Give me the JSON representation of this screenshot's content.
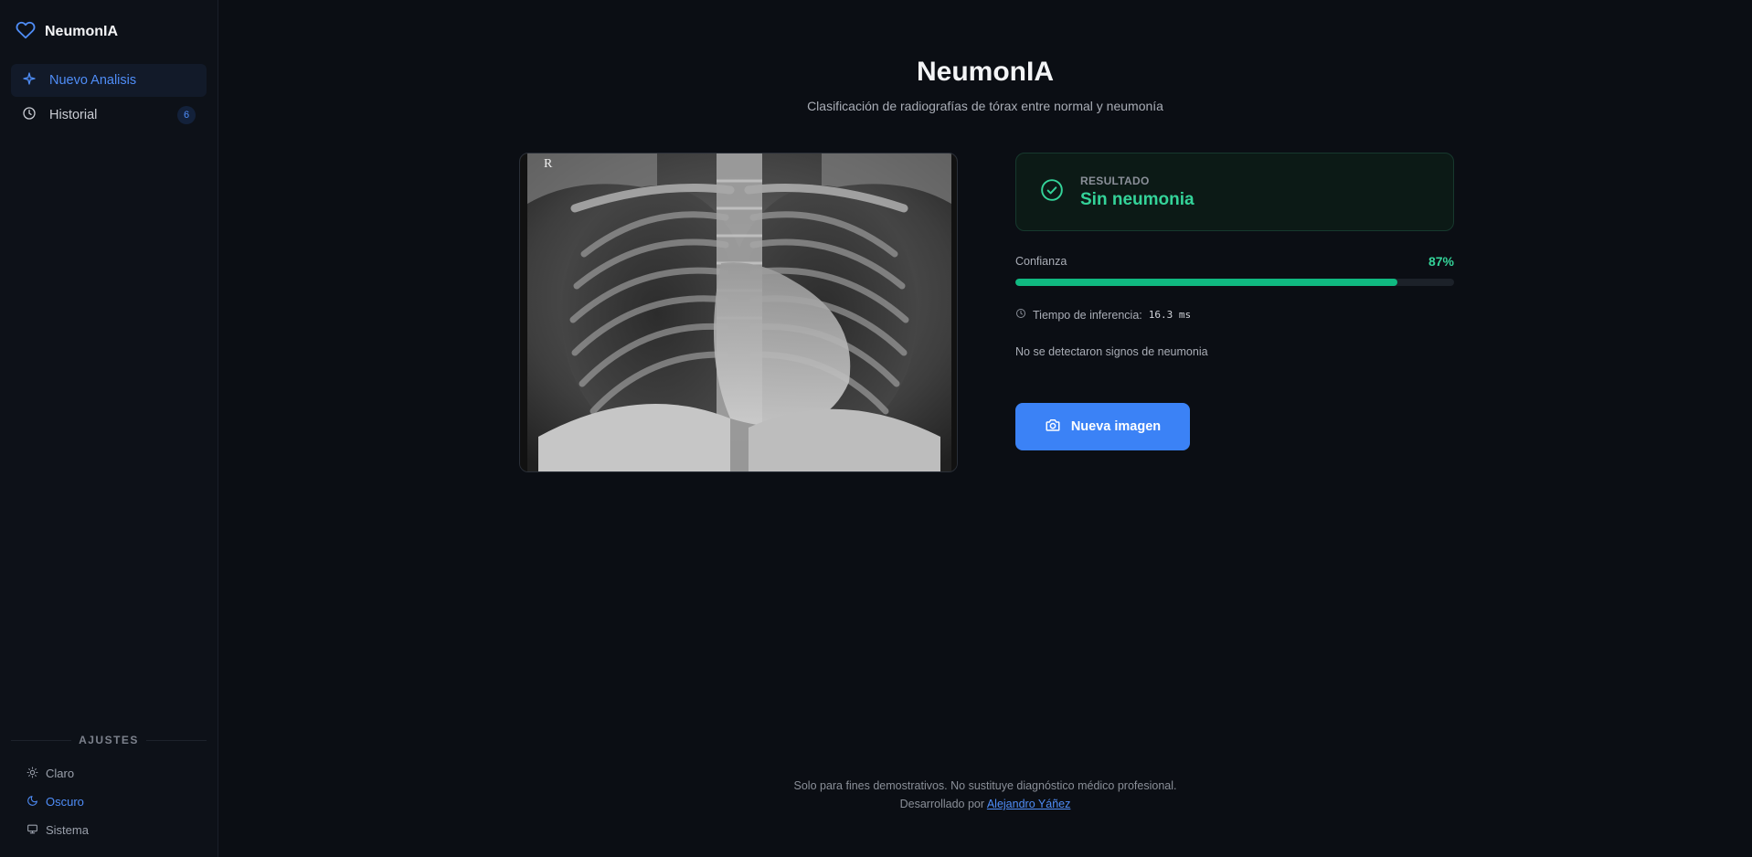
{
  "sidebar": {
    "brand": "NeumonIA",
    "nav": [
      {
        "label": "Nuevo Analisis",
        "active": true
      },
      {
        "label": "Historial",
        "badge": "6"
      }
    ],
    "settings": {
      "title": "AJUSTES",
      "themes": [
        {
          "label": "Claro"
        },
        {
          "label": "Oscuro",
          "active": true
        },
        {
          "label": "Sistema"
        }
      ]
    }
  },
  "main": {
    "title": "NeumonIA",
    "subtitle": "Clasificación de radiografías de tórax entre normal y neumonía",
    "xray_marker": "R",
    "result": {
      "label": "RESULTADO",
      "value": "Sin neumonia"
    },
    "confidence": {
      "label": "Confianza",
      "percent_text": "87%",
      "value": 87
    },
    "inference": {
      "label": "Tiempo de inferencia:",
      "value": "16.3 ms"
    },
    "note": "No se detectaron signos de neumonia",
    "new_image_button": "Nueva imagen"
  },
  "footer": {
    "disclaimer": "Solo para fines demostrativos. No sustituye diagnóstico médico profesional.",
    "developed_by": "Desarrollado por",
    "author": "Alejandro Yáñez"
  },
  "colors": {
    "accent": "#3b82f6",
    "success": "#34d399",
    "background": "#0b0e14"
  }
}
